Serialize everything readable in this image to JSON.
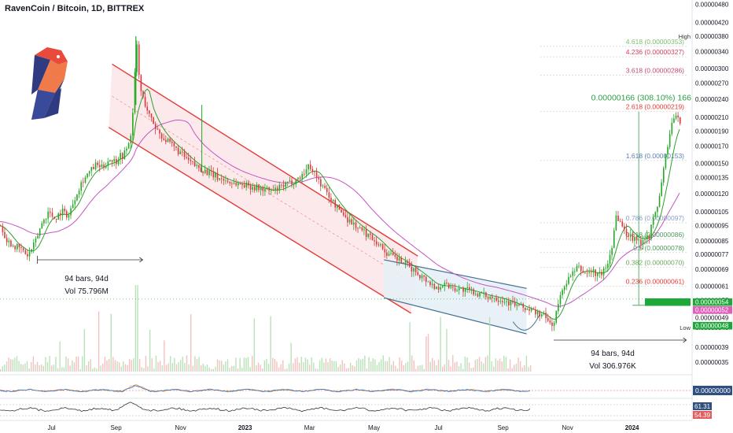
{
  "header": {
    "title": "RavenCoin / Bitcoin, 1D, BITTREX"
  },
  "logo": {
    "icon": "ravencoin-raven-logo-icon",
    "colors": [
      "#e84a3b",
      "#f07a4a",
      "#2f3a80",
      "#3a4a9a"
    ]
  },
  "colors": {
    "up": "#26a626",
    "down": "#d63a3a",
    "channel_red": "#e53935",
    "channel_fill": "#fbe3e6",
    "channel_blue": "#3f6f8f",
    "channel_blue_fill": "#e6f0f6",
    "ma_green": "#2ca02c",
    "ma_purple": "#c455c4",
    "fib_line": "#d0d0d0",
    "measure_green": "#2ea043",
    "label_green": "#1fa83a",
    "label_pink": "#e45dbb"
  },
  "chart_data": [
    {
      "type": "candlestick",
      "title": "RavenCoin / Bitcoin, 1D, BITTREX",
      "y_axis": {
        "scale": "log",
        "ylim": [
          3.3e-08,
          4.9e-07
        ],
        "tick_labels": [
          "0.00000480",
          "0.00000420",
          "0.00000380",
          "0.00000340",
          "0.00000300",
          "0.00000270",
          "0.00000240",
          "0.00000210",
          "0.00000190",
          "0.00000170",
          "0.00000150",
          "0.00000135",
          "0.00000120",
          "0.00000105",
          "0.00000095",
          "0.00000085",
          "0.00000077",
          "0.00000069",
          "0.00000061",
          "0.00000055",
          "0.00000049",
          "0.00000045",
          "0.00000039",
          "0.00000035"
        ],
        "tick_values": [
          4.8e-07,
          4.2e-07,
          3.8e-07,
          3.4e-07,
          3e-07,
          2.7e-07,
          2.4e-07,
          2.1e-07,
          1.9e-07,
          1.7e-07,
          1.5e-07,
          1.35e-07,
          1.2e-07,
          1.05e-07,
          9.5e-08,
          8.5e-08,
          7.7e-08,
          6.9e-08,
          6.1e-08,
          5.5e-08,
          4.9e-08,
          4.5e-08,
          3.9e-08,
          3.5e-08
        ]
      },
      "x_axis": {
        "tick_labels": [
          "Jul",
          "Sep",
          "Nov",
          "2023",
          "Mar",
          "May",
          "Jul",
          "Sep",
          "Nov",
          "2024"
        ],
        "tick_positions": [
          0.08,
          0.18,
          0.28,
          0.38,
          0.48,
          0.58,
          0.68,
          0.78,
          0.88,
          0.98
        ]
      },
      "price_path": [
        [
          0.0,
          9.5e-08
        ],
        [
          0.01,
          8.5e-08
        ],
        [
          0.02,
          8.2e-08
        ],
        [
          0.03,
          8e-08
        ],
        [
          0.04,
          7.6e-08
        ],
        [
          0.05,
          8.3e-08
        ],
        [
          0.06,
          9.6e-08
        ],
        [
          0.07,
          1.05e-07
        ],
        [
          0.08,
          1e-07
        ],
        [
          0.09,
          1.06e-07
        ],
        [
          0.1,
          1.02e-07
        ],
        [
          0.11,
          1.18e-07
        ],
        [
          0.12,
          1.32e-07
        ],
        [
          0.13,
          1.4e-07
        ],
        [
          0.14,
          1.48e-07
        ],
        [
          0.15,
          1.45e-07
        ],
        [
          0.16,
          1.55e-07
        ],
        [
          0.17,
          1.52e-07
        ],
        [
          0.175,
          1.6e-07
        ],
        [
          0.18,
          1.58e-07
        ],
        [
          0.19,
          1.75e-07
        ],
        [
          0.195,
          2.2e-07
        ],
        [
          0.2,
          3.7e-07
        ],
        [
          0.205,
          2.6e-07
        ],
        [
          0.21,
          2.4e-07
        ],
        [
          0.22,
          2.1e-07
        ],
        [
          0.23,
          1.92e-07
        ],
        [
          0.24,
          1.8e-07
        ],
        [
          0.26,
          1.65e-07
        ],
        [
          0.28,
          1.5e-07
        ],
        [
          0.3,
          1.42e-07
        ],
        [
          0.32,
          1.35e-07
        ],
        [
          0.34,
          1.3e-07
        ],
        [
          0.36,
          1.28e-07
        ],
        [
          0.38,
          1.25e-07
        ],
        [
          0.4,
          1.22e-07
        ],
        [
          0.42,
          1.28e-07
        ],
        [
          0.44,
          1.35e-07
        ],
        [
          0.455,
          1.48e-07
        ],
        [
          0.47,
          1.3e-07
        ],
        [
          0.49,
          1.12e-07
        ],
        [
          0.51,
          1e-07
        ],
        [
          0.53,
          9.2e-08
        ],
        [
          0.55,
          8.6e-08
        ],
        [
          0.57,
          7.7e-08
        ],
        [
          0.59,
          7.3e-08
        ],
        [
          0.61,
          6.8e-08
        ],
        [
          0.63,
          6.3e-08
        ],
        [
          0.64,
          6e-08
        ],
        [
          0.65,
          6.2e-08
        ],
        [
          0.67,
          6e-08
        ],
        [
          0.69,
          5.9e-08
        ],
        [
          0.71,
          5.7e-08
        ],
        [
          0.73,
          5.6e-08
        ],
        [
          0.75,
          5.4e-08
        ],
        [
          0.77,
          5.2e-08
        ],
        [
          0.79,
          5e-08
        ],
        [
          0.8,
          4.9e-08
        ],
        [
          0.81,
          4.6e-08
        ],
        [
          0.815,
          4.7e-08
        ],
        [
          0.82,
          5.3e-08
        ],
        [
          0.83,
          6.2e-08
        ],
        [
          0.84,
          6.6e-08
        ],
        [
          0.85,
          7e-08
        ],
        [
          0.86,
          6.7e-08
        ],
        [
          0.87,
          6.8e-08
        ],
        [
          0.88,
          6.6e-08
        ],
        [
          0.89,
          6.9e-08
        ],
        [
          0.895,
          7.4e-08
        ],
        [
          0.9,
          8.3e-08
        ],
        [
          0.905,
          1.02e-07
        ],
        [
          0.91,
          1e-07
        ],
        [
          0.915,
          9.4e-08
        ],
        [
          0.92,
          9e-08
        ],
        [
          0.93,
          8.7e-08
        ],
        [
          0.935,
          8.8e-08
        ],
        [
          0.94,
          8.3e-08
        ],
        [
          0.945,
          8.6e-08
        ],
        [
          0.95,
          8.9e-08
        ],
        [
          0.955,
          8.8e-08
        ],
        [
          0.96,
          1e-07
        ],
        [
          0.965,
          1.05e-07
        ],
        [
          0.97,
          1.2e-07
        ],
        [
          0.975,
          1.4e-07
        ],
        [
          0.98,
          1.65e-07
        ],
        [
          0.985,
          1.85e-07
        ],
        [
          0.99,
          2.1e-07
        ],
        [
          1.0,
          2.05e-07
        ]
      ],
      "fibonacci": [
        {
          "label": "4.618 (0.00000353)",
          "value": 3.53e-07,
          "color": "#7cbf6a"
        },
        {
          "label": "4.236 (0.00000327)",
          "value": 3.27e-07,
          "color": "#d83c5c"
        },
        {
          "label": "3.618 (0.00000286)",
          "value": 2.86e-07,
          "color": "#c24a70"
        },
        {
          "label": "2.618 (0.00000219)",
          "value": 2.19e-07,
          "color": "#e53935"
        },
        {
          "label": "1.618 (0.00000153)",
          "value": 1.53e-07,
          "color": "#5a7fb0"
        },
        {
          "label": "0.786 (0.00000097)",
          "value": 9.7e-08,
          "color": "#8aa0c6"
        },
        {
          "label": "0.618 (0.00000086)",
          "value": 8.6e-08,
          "color": "#4a9a5a"
        },
        {
          "label": "0.5 (0.00000078)",
          "value": 7.8e-08,
          "color": "#4a9a5a"
        },
        {
          "label": "0.382 (0.00000070)",
          "value": 7e-08,
          "color": "#6aaa5a"
        },
        {
          "label": "0.236 (0.00000061)",
          "value": 6.1e-08,
          "color": "#e53935"
        }
      ],
      "measure": {
        "label": "0.00000166 (308.10%) 166",
        "from": 5.3e-08,
        "to": 2.19e-07
      },
      "annotations": [
        {
          "line1": "94 bars, 94d",
          "line2": "Vol 75.796M"
        },
        {
          "line1": "94 bars, 94d",
          "line2": "Vol 306.976K"
        }
      ],
      "axis_markers": {
        "high": {
          "label": "High",
          "value": 3.8e-07
        },
        "low": {
          "label": "Low",
          "value": 4.5e-08
        },
        "tags": [
          {
            "text": "0.00000054",
            "value": 5.55e-08,
            "color": "#1fa83a"
          },
          {
            "text": "0.00000052",
            "value": 5.2e-08,
            "color": "#e45dbb"
          },
          {
            "text": "0.00000049",
            "value": 4.95e-08,
            "color": "#ffffff"
          },
          {
            "text": "0.00000048",
            "value": 4.75e-08,
            "color": "#1fa83a"
          }
        ]
      }
    },
    {
      "type": "oscillator",
      "tag": "0.00000000",
      "tag_color": "#2f4f7f"
    },
    {
      "type": "oscillator",
      "tags": [
        {
          "text": "61.31",
          "color": "#2f4f7f"
        },
        {
          "text": "54.39",
          "color": "#e45d5d"
        }
      ]
    }
  ]
}
